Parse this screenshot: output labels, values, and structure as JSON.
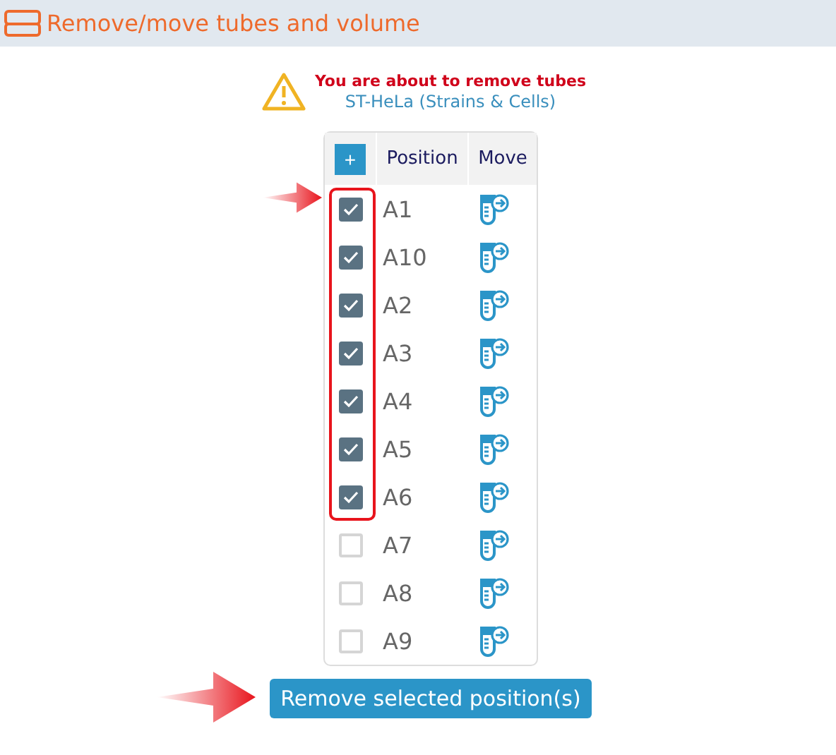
{
  "header": {
    "title": "Remove/move tubes and volume"
  },
  "warning": {
    "message": "You are about to remove tubes",
    "subject": "ST-HeLa (Strains & Cells)"
  },
  "table": {
    "add_button": "+",
    "columns": [
      "Position",
      "Move"
    ],
    "rows": [
      {
        "position": "A1",
        "checked": true
      },
      {
        "position": "A10",
        "checked": true
      },
      {
        "position": "A2",
        "checked": true
      },
      {
        "position": "A3",
        "checked": true
      },
      {
        "position": "A4",
        "checked": true
      },
      {
        "position": "A5",
        "checked": true
      },
      {
        "position": "A6",
        "checked": true
      },
      {
        "position": "A7",
        "checked": false
      },
      {
        "position": "A8",
        "checked": false
      },
      {
        "position": "A9",
        "checked": false
      }
    ]
  },
  "remove_button": "Remove selected position(s)"
}
